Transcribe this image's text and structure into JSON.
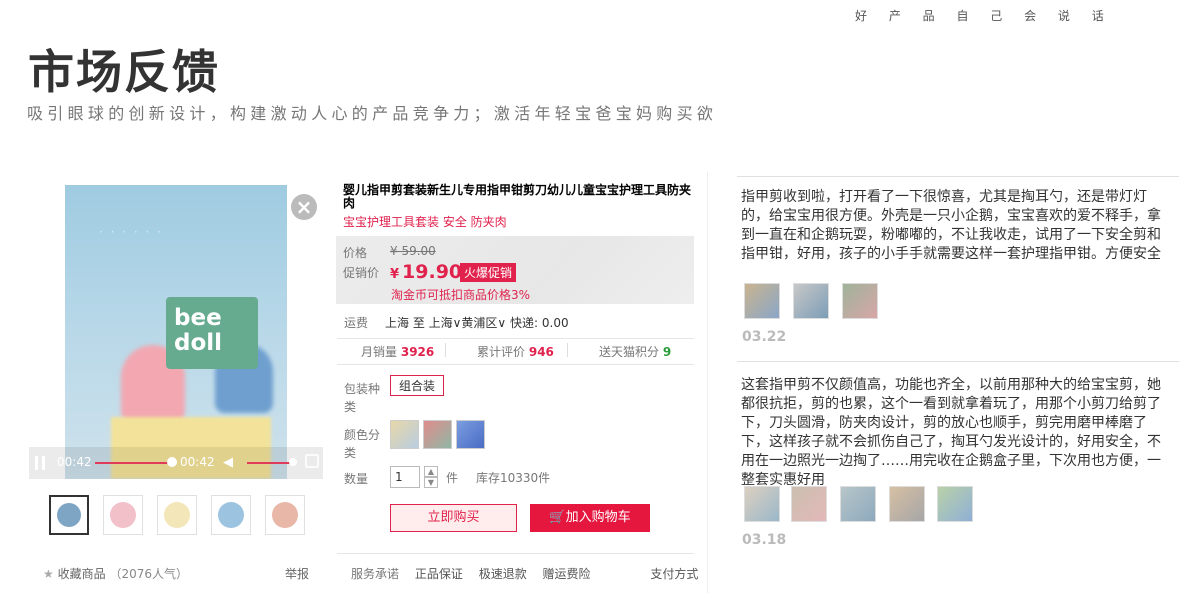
{
  "header": {
    "tagline": "好 产 品 自 己 会 说 话",
    "title": "市场反馈",
    "subtitle": "吸引眼球的创新设计，构建激动人心的产品竞争力；激活年轻宝爸宝妈购买欲"
  },
  "gallery": {
    "logo_line1": "bee",
    "logo_line2": "doll",
    "player": {
      "current_time": "00:42",
      "duration": "00:42",
      "progress": 1.0
    },
    "thumbnail_count": 5,
    "favorite_label": "收藏商品",
    "favorite_count": "（2076人气）",
    "report_label": "举报"
  },
  "product": {
    "title": "婴儿指甲剪套装新生儿专用指甲钳剪刀幼儿儿童宝宝护理工具防夹肉",
    "subtitle": "宝宝护理工具套装 安全 防夹肉",
    "price_label": "价格",
    "original_price": "¥ 59.00",
    "promo_label": "促销价",
    "currency": "¥",
    "promo_price": "19.90",
    "promo_tag": "火爆促销",
    "coin_note": "淘金币可抵扣商品价格3%",
    "shipping_label": "运费",
    "shipping_text": "上海 至 上海∨黄浦区∨ 快递: 0.00",
    "stats": {
      "monthly_sales_label": "月销量",
      "monthly_sales": "3926",
      "reviews_label": "累计评价",
      "reviews": "946",
      "points_label": "送天猫积分",
      "points": "9"
    },
    "package_label": "包装种类",
    "package_option": "组合装",
    "color_label": "颜色分类",
    "qty_label": "数量",
    "qty_value": "1",
    "qty_unit": "件",
    "stock": "库存10330件",
    "buy_now": "立即购买",
    "add_cart": "加入购物车",
    "services": {
      "label": "服务承诺",
      "items": [
        "正品保证",
        "极速退款",
        "赠运费险"
      ],
      "pay_label": "支付方式"
    }
  },
  "reviews": [
    {
      "text": "指甲剪收到啦，打开看了一下很惊喜，尤其是掏耳勺，还是带灯灯的，给宝宝用很方便。外壳是一只小企鹅，宝宝喜欢的爱不释手，拿到一直在和企鹅玩耍，粉嘟嘟的，不让我收走，试用了一下安全剪和指甲钳，好用，孩子的小手手就需要这样一套护理指甲钳。方便安全",
      "date": "03.22"
    },
    {
      "text": "这套指甲剪不仅颜值高，功能也齐全，以前用那种大的给宝宝剪，她都很抗拒，剪的也累，这个一看到就拿着玩了，用那个小剪刀给剪了下，刀头圆滑，防夹肉设计，剪的放心也顺手，剪完用磨甲棒磨了下，这样孩子就不会抓伤自己了，掏耳勺发光设计的，好用安全，不用在一边照光一边掏了……用完收在企鹅盒子里，下次用也方便，一整套实惠好用",
      "date": "03.18"
    }
  ],
  "colors": {
    "accent": "#e0224d",
    "brand_green": "#66ab8f"
  }
}
